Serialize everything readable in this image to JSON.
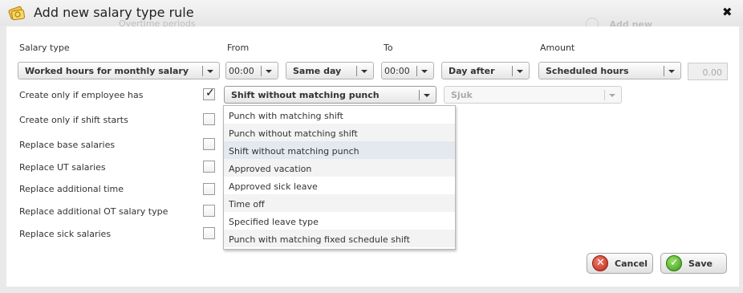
{
  "window": {
    "title": "Add new salary type rule"
  },
  "background": {
    "overtime_periods": "Overtime periods",
    "add_new": "Add new"
  },
  "columns": {
    "salary_type": "Salary type",
    "from": "From",
    "to": "To",
    "amount": "Amount"
  },
  "row1": {
    "salary_type": "Worked hours for monthly salary",
    "from_time": "00:00",
    "from_day": "Same day",
    "to_time": "00:00",
    "to_day": "Day after",
    "amount_type": "Scheduled hours",
    "amount_value": "0.00"
  },
  "conditions": [
    {
      "label": "Create only if employee has",
      "checked": true
    },
    {
      "label": "Create only if shift starts",
      "checked": false
    },
    {
      "label": "Replace base salaries",
      "checked": false
    },
    {
      "label": "Replace UT salaries",
      "checked": false
    },
    {
      "label": "Replace additional time",
      "checked": false
    },
    {
      "label": "Replace additional OT salary type",
      "checked": false
    },
    {
      "label": "Replace sick salaries",
      "checked": false
    }
  ],
  "employee_has": {
    "selected": "Shift without matching punch",
    "leave_type": "Sjuk"
  },
  "dropdown": {
    "options": [
      "Punch with matching shift",
      "Punch without matching shift",
      "Shift without matching punch",
      "Approved vacation",
      "Approved sick leave",
      "Time off",
      "Specified leave type",
      "Punch with matching fixed schedule shift"
    ],
    "highlighted_index": 2
  },
  "buttons": {
    "cancel": "Cancel",
    "save": "Save"
  },
  "icons": {
    "title": "salary-rule-icon",
    "close": "close-icon",
    "cancel": "cancel-icon",
    "save": "save-icon",
    "check": "check-icon"
  },
  "colors": {
    "dialog_bg": "#e9e9e9",
    "content_bg": "#ffffff",
    "highlight": "#e4e8ef",
    "cancel": "#c0281c",
    "save": "#3a9a17"
  }
}
